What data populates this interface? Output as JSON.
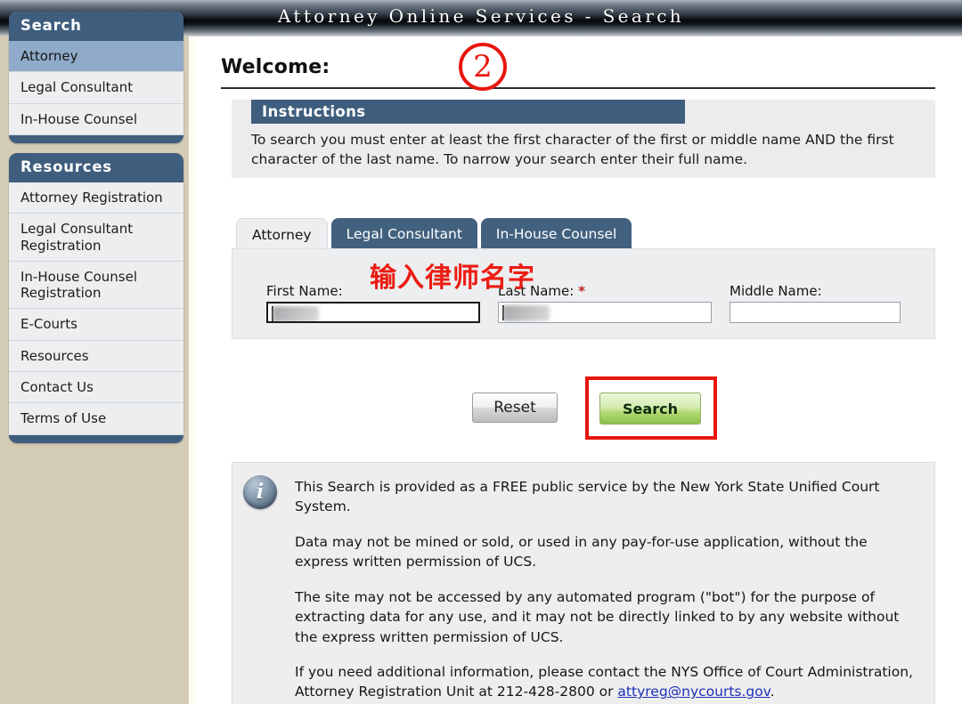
{
  "banner": {
    "title": "Attorney Online Services - Search"
  },
  "sidebar": {
    "groups": [
      {
        "heading": "Search",
        "items": [
          {
            "label": "Attorney",
            "active": true
          },
          {
            "label": "Legal Consultant",
            "active": false
          },
          {
            "label": "In-House Counsel",
            "active": false
          }
        ]
      },
      {
        "heading": "Resources",
        "items": [
          {
            "label": "Attorney Registration",
            "active": false
          },
          {
            "label": "Legal Consultant Registration",
            "active": false
          },
          {
            "label": "In-House Counsel Registration",
            "active": false
          },
          {
            "label": "E-Courts",
            "active": false
          },
          {
            "label": "Resources",
            "active": false
          },
          {
            "label": "Contact Us",
            "active": false
          },
          {
            "label": "Terms of Use",
            "active": false
          }
        ]
      }
    ]
  },
  "main": {
    "welcome": "Welcome:",
    "instructions": {
      "title": "Instructions",
      "body": "To search you must enter at least the first character of the first or middle name AND the first character of the last name. To narrow your search enter their full name."
    },
    "tabs": [
      {
        "label": "Attorney",
        "active": true
      },
      {
        "label": "Legal Consultant",
        "active": false
      },
      {
        "label": "In-House Counsel",
        "active": false
      }
    ],
    "form": {
      "first_name": {
        "label": "First Name:",
        "value": "",
        "redacted": true,
        "focused": true
      },
      "last_name": {
        "label": "Last Name:",
        "required_mark": "*",
        "value": "",
        "redacted": true,
        "focused": false
      },
      "middle_name": {
        "label": "Middle Name:",
        "value": "",
        "redacted": false,
        "focused": false
      }
    },
    "buttons": {
      "reset": "Reset",
      "search": "Search"
    },
    "disclaimer": {
      "icon": "info-icon",
      "paragraphs": [
        "This Search is provided as a FREE public service by the New York State Unified Court System.",
        "Data may not be mined or sold, or used in any pay-for-use application, without the express written permission of UCS.",
        "The site may not be accessed by any automated program (\"bot\") for the purpose of extracting data for any use, and it may not be directly linked to by any website without the express written permission of UCS."
      ],
      "contact_prefix": "If you need additional information, please contact the NYS Office of Court Administration, Attorney Registration Unit at 212-428-2800 or ",
      "contact_email": "attyreg@nycourts.gov",
      "contact_suffix": "."
    }
  },
  "annotations": {
    "step_number": "②",
    "step_number_plain": "2",
    "chinese_note": "输入律师名字",
    "highlight_color": "#e8160c"
  },
  "colors": {
    "header_dark": "#05070a",
    "panel_header_blue": "#3f5e7e",
    "sidebar_beige": "#d5ccb6",
    "active_nav_blue": "#8fabc9",
    "tab_inactive": "#42617f",
    "panel_grey": "#eceef0",
    "search_green": "#8cc04a",
    "link_blue": "#1c2fb8",
    "annotation_red": "#ec1c13"
  }
}
